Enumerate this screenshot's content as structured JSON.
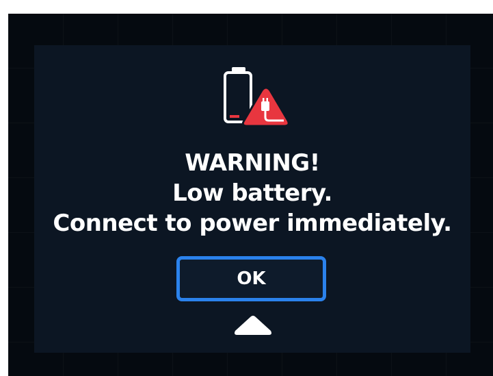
{
  "dialog": {
    "icon": "battery-low-power-warning-icon",
    "title": "WARNING!",
    "line1": "Low battery.",
    "line2": "Connect to power immediately.",
    "ok_label": "OK",
    "scroll_icon": "triangle-up-icon"
  },
  "colors": {
    "screen_bg": "#050a10",
    "dialog_bg": "#0c1623",
    "warning_red": "#e8363f",
    "button_border": "#2b82ec",
    "text": "#ffffff"
  }
}
